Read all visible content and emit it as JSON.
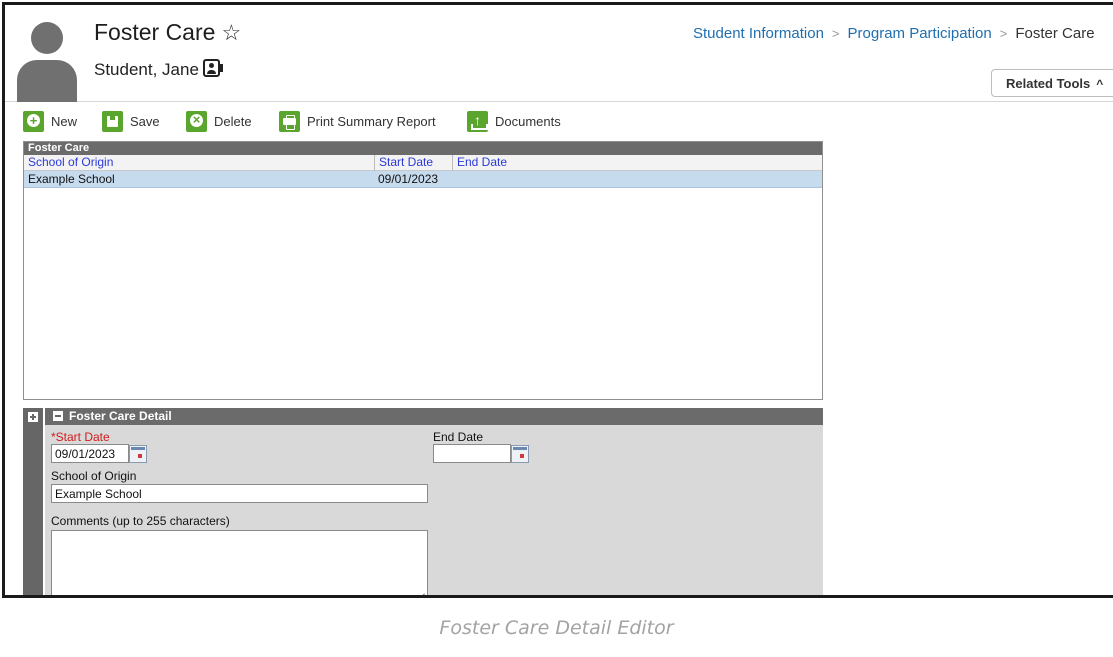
{
  "header": {
    "title": "Foster Care",
    "favorite_icon": "star-outline-icon",
    "student_name": "Student, Jane",
    "contact_icon": "contact-card-icon",
    "breadcrumb": [
      {
        "label": "Student Information",
        "type": "link"
      },
      {
        "label": "Program Participation",
        "type": "link"
      },
      {
        "label": "Foster Care",
        "type": "current"
      }
    ],
    "breadcrumb_separator": ">",
    "related_tools_label": "Related Tools",
    "related_tools_icon": "chevron-up-icon"
  },
  "toolbar": {
    "new_label": "New",
    "save_label": "Save",
    "delete_label": "Delete",
    "print_label": "Print Summary Report",
    "documents_label": "Documents",
    "accent_color": "#5aa52d"
  },
  "list": {
    "title": "Foster Care",
    "columns": [
      "School of Origin",
      "Start Date",
      "End Date"
    ],
    "rows": [
      {
        "school": "Example School",
        "start": "09/01/2023",
        "end": ""
      }
    ],
    "selected_row_color": "#c7dbee",
    "header_text_color": "#2b39d8"
  },
  "detail": {
    "title": "Foster Care Detail",
    "start_date_label": "*Start Date",
    "start_date_value": "09/01/2023",
    "end_date_label": "End Date",
    "end_date_value": "",
    "school_label": "School of Origin",
    "school_value": "Example School",
    "comments_label": "Comments (up to 255 characters)",
    "comments_value": "",
    "required_color": "#d21d1d"
  },
  "caption": "Foster Care Detail Editor"
}
